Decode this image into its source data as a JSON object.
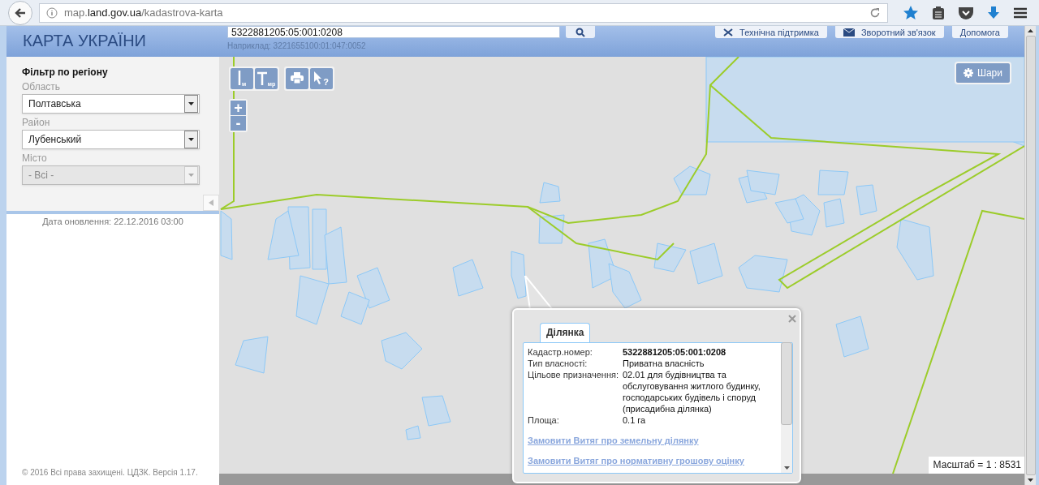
{
  "browser": {
    "url": "map.**land.gov.ua**/kadastrova-karta"
  },
  "header": {
    "logo": "КАРТА УКРАЇНИ",
    "search": {
      "value": "5322881205:05:001:0208",
      "hint": "Наприклад: 3221655100:01:047:0052"
    },
    "buttons": [
      {
        "kind": "support",
        "label": "Технічна підтримка"
      },
      {
        "kind": "feedback",
        "label": "Зворотний зв'язок"
      },
      {
        "kind": "help",
        "label": "Допомога"
      }
    ]
  },
  "filter": {
    "title": "Фільтр по регіону",
    "fields": [
      {
        "label": "Область",
        "value": "Полтавська",
        "disabled": false
      },
      {
        "label": "Район",
        "value": "Лубенський",
        "disabled": false
      },
      {
        "label": "Місто",
        "value": "- Всі -",
        "disabled": true
      }
    ],
    "updated": "Дата оновлення: 22.12.2016 03:00",
    "copyright": "© 2016 Всі права захищені. ЦДЗК. Версія 1.17."
  },
  "map": {
    "tools": [
      {
        "kind": "distance",
        "label": "м"
      },
      {
        "kind": "area",
        "label": "мр"
      },
      {
        "kind": "print"
      },
      {
        "kind": "identify",
        "label": "?"
      }
    ],
    "zoom": [
      "+",
      "-"
    ],
    "layers": "Шари",
    "scale": "Масштаб = 1 : 8531"
  },
  "popup": {
    "tab": "Ділянка",
    "rows": [
      {
        "label": "Кадастр.номер:",
        "value": "5322881205:05:001:0208",
        "strong": true
      },
      {
        "label": "Тип власності:",
        "value": "Приватна власність",
        "strong": false
      },
      {
        "label": "Цільове призначення:",
        "value": "02.01 для будівництва та обслуговування житлого будинку, господарських будівель і споруд (присадибна ділянка)",
        "strong": false
      },
      {
        "label": "Площа:",
        "value": "0.1 га",
        "strong": false
      }
    ],
    "links": [
      "Замовити Витяг про земельну ділянку",
      "Замовити Витяг про нормативну грошову оцінку"
    ]
  }
}
